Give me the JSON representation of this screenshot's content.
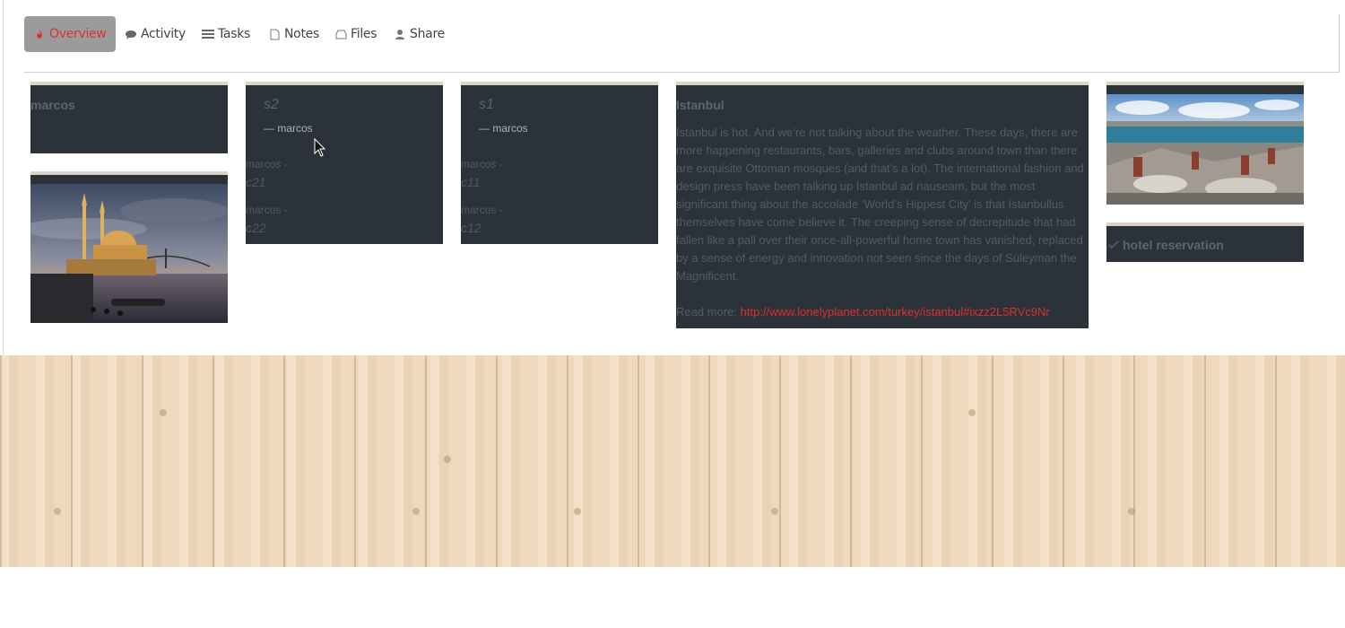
{
  "tabs": [
    {
      "label": "Overview",
      "icon": "flame-icon",
      "active": true
    },
    {
      "label": "Activity",
      "icon": "speech-bubble-icon",
      "active": false
    },
    {
      "label": "Tasks",
      "icon": "list-icon",
      "active": false
    },
    {
      "label": "Notes",
      "icon": "document-icon",
      "active": false
    },
    {
      "label": "Files",
      "icon": "inbox-icon",
      "active": false
    },
    {
      "label": "Share",
      "icon": "user-icon",
      "active": false
    }
  ],
  "cards": {
    "marcos_card": {
      "title": "marcos"
    },
    "s2": {
      "title": "s2",
      "author": "— marcos",
      "comments": [
        {
          "author": "marcos -",
          "text": "c21"
        },
        {
          "author": "marcos -",
          "text": "c22"
        }
      ]
    },
    "s1": {
      "title": "s1",
      "author": "— marcos",
      "comments": [
        {
          "author": "marcos -",
          "text": "c11"
        },
        {
          "author": "marcos -",
          "text": "c12"
        }
      ]
    },
    "istanbul": {
      "title": "Istanbul",
      "body": "Istanbul is hot. And we’re not talking about the weather. These days, there are more happening restaurants, bars, galleries and clubs around town than there are exquisite Ottoman mosques (and that’s a lot). The international fashion and design press have been talking up İstanbul ad nauseam, but the most significant thing about the accolade ‘World’s Hippest City’ is that İstanbullus themselves have come believe it. The creeping sense of decrepitude that had fallen like a pall over their once-all-powerful home town has vanished, replaced by a sense of energy and innovation not seen since the days of Süleyman the Magnificent.",
      "read_more_label": "Read more:",
      "read_more_url": "http://www.lonelyplanet.com/turkey/istanbul#ixzz2L5RVc9Nr"
    },
    "hotel": {
      "title": "hotel reservation",
      "icon": "check-icon"
    }
  },
  "colors": {
    "accent": "#d8332a",
    "card_bg": "#2b323a",
    "card_border": "#ddd3c4",
    "tab_active_bg": "#9b9b9b"
  }
}
